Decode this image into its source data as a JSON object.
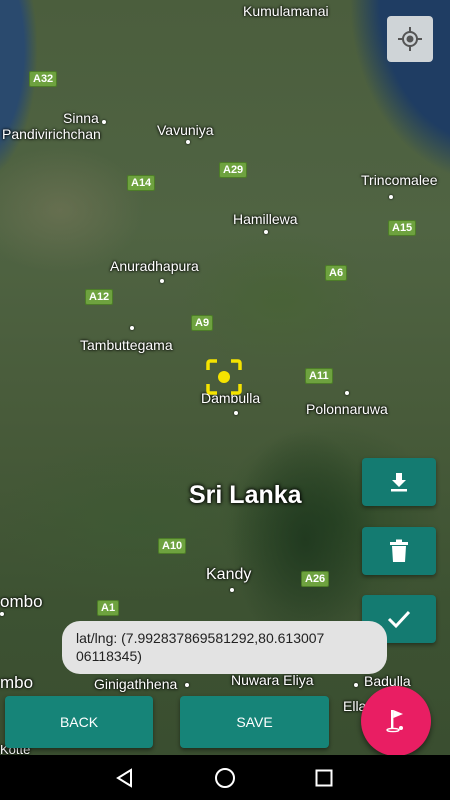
{
  "map": {
    "country": "Sri Lanka",
    "towns": [
      {
        "name": "Kumulamanai"
      },
      {
        "name": "Sinna"
      },
      {
        "name": "Pandivirichchan"
      },
      {
        "name": "Vavuniya"
      },
      {
        "name": "Trincomalee"
      },
      {
        "name": "Hamillewa"
      },
      {
        "name": "Anuradhapura"
      },
      {
        "name": "Tambuttegama"
      },
      {
        "name": "Dambulla"
      },
      {
        "name": "Polonnaruwa"
      },
      {
        "name": "Kandy"
      },
      {
        "name": "ombo"
      },
      {
        "name": "mbo"
      },
      {
        "name": "Ginigathhena"
      },
      {
        "name": "Nuwara Eliya"
      },
      {
        "name": "Badulla"
      },
      {
        "name": "Ella"
      },
      {
        "name": "Kotte"
      }
    ],
    "roads": [
      "A32",
      "A29",
      "A14",
      "A15",
      "A6",
      "A12",
      "A9",
      "A11",
      "A10",
      "A26",
      "A1"
    ]
  },
  "toast": {
    "text": "lat/lng: (7.992837869581292,80.613007 06118345)"
  },
  "buttons": {
    "back": "BACK",
    "save": "SAVE"
  },
  "icons": {
    "locate": "my-location-icon",
    "download": "download-icon",
    "delete": "trash-icon",
    "confirm": "check-icon",
    "flag": "golf-flag-icon",
    "nav_back": "triangle-back-icon",
    "nav_home": "circle-home-icon",
    "nav_recent": "square-recent-icon"
  },
  "colors": {
    "fab_teal": "#147b71",
    "accent_pink": "#e91e63",
    "marker_yellow": "#f5e300"
  }
}
